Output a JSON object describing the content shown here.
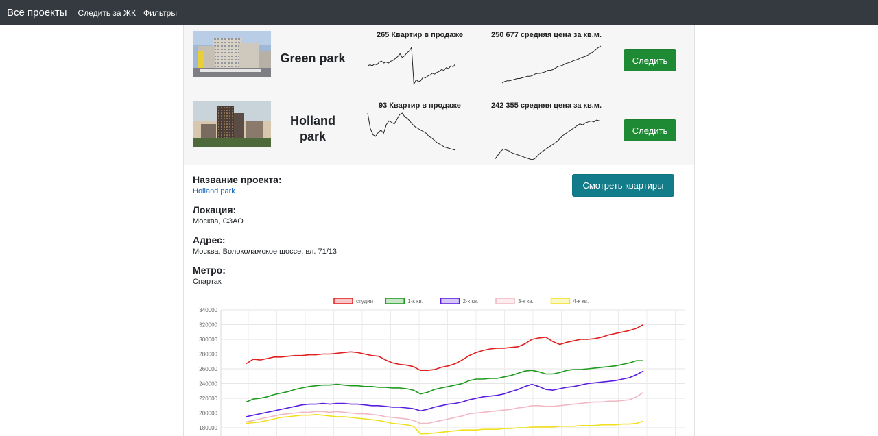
{
  "navbar": {
    "brand": "Все проекты",
    "links": [
      "Следить за ЖК",
      "Фильтры"
    ]
  },
  "projects": [
    {
      "name": "Green park",
      "flats_label": "265 Квартир в продаже",
      "price_label": "250 677 средняя цена за кв.м.",
      "follow_label": "Следить",
      "flats_trend": [
        20,
        21,
        20,
        22,
        21,
        24,
        25,
        23,
        24,
        23,
        25,
        26,
        28,
        30,
        33,
        29,
        31,
        34,
        36,
        40,
        0,
        5,
        3,
        4,
        8,
        7,
        9,
        10,
        12,
        11,
        13,
        14,
        16,
        15,
        18,
        17,
        20,
        19,
        22
      ],
      "price_trend": [
        0,
        2,
        3,
        3,
        4,
        5,
        6,
        6,
        7,
        8,
        9,
        9,
        10,
        12,
        13,
        13,
        14,
        15,
        17,
        17,
        18,
        20,
        22,
        23,
        24,
        26,
        27,
        28,
        30,
        31,
        32,
        34,
        35,
        36,
        38,
        40,
        42,
        45,
        48,
        50
      ]
    },
    {
      "name": "Holland park",
      "flats_label": "93 Квартир в продаже",
      "price_label": "242 355 средняя цена за кв.м.",
      "follow_label": "Следить",
      "flats_trend": [
        50,
        30,
        22,
        20,
        25,
        28,
        24,
        35,
        40,
        38,
        36,
        42,
        48,
        50,
        45,
        43,
        39,
        35,
        32,
        30,
        28,
        26,
        24,
        20,
        18,
        15,
        12,
        10,
        8,
        6,
        5,
        4,
        3,
        2
      ],
      "price_trend": [
        10,
        14,
        18,
        20,
        19,
        18,
        16,
        15,
        14,
        13,
        12,
        11,
        10,
        9,
        10,
        13,
        16,
        18,
        20,
        22,
        24,
        26,
        28,
        31,
        34,
        36,
        38,
        40,
        42,
        44,
        46,
        45,
        47,
        48,
        49,
        48,
        50,
        49
      ]
    }
  ],
  "details": {
    "name_heading": "Название проекта:",
    "name_value": "Holland park",
    "location_heading": "Локация:",
    "location_value": "Москва, СЗАО",
    "address_heading": "Адрес:",
    "address_value": "Москва, Волоколамское шоссе, вл. 71/13",
    "metro_heading": "Метро:",
    "metro_value": "Спартак",
    "view_button": "Смотреть квартиры"
  },
  "chart_data": {
    "type": "line",
    "title": "",
    "legend_position": "top",
    "grid": true,
    "ylim": [
      170000,
      340000
    ],
    "yticks": [
      340000,
      320000,
      300000,
      280000,
      260000,
      240000,
      220000,
      200000,
      180000
    ],
    "x_count": 58,
    "series": [
      {
        "name": "студии",
        "color": "#e02020",
        "values": [
          267000,
          273000,
          272000,
          274000,
          276000,
          276000,
          277000,
          278000,
          278000,
          279000,
          279000,
          280000,
          280000,
          281000,
          282000,
          283000,
          282000,
          280000,
          278000,
          277000,
          272000,
          268000,
          266000,
          265000,
          263000,
          258000,
          258000,
          259000,
          262000,
          264000,
          267000,
          272000,
          278000,
          282000,
          285000,
          287000,
          288000,
          288000,
          289000,
          290000,
          294000,
          300000,
          302000,
          303000,
          297000,
          293000,
          296000,
          298000,
          300000,
          300000,
          301000,
          303000,
          306000,
          308000,
          310000,
          312000,
          315000,
          320000
        ]
      },
      {
        "name": "1-к кв.",
        "color": "#1e9a1e",
        "values": [
          215000,
          219000,
          220000,
          222000,
          225000,
          227000,
          229000,
          232000,
          234000,
          236000,
          237000,
          238000,
          238000,
          239000,
          238000,
          237000,
          237000,
          236000,
          236000,
          235000,
          235000,
          234000,
          234000,
          233000,
          231000,
          226000,
          228000,
          232000,
          234000,
          236000,
          238000,
          240000,
          244000,
          246000,
          246000,
          247000,
          247000,
          249000,
          251000,
          254000,
          257000,
          258000,
          256000,
          253000,
          253000,
          255000,
          258000,
          259000,
          259000,
          260000,
          261000,
          262000,
          263000,
          264000,
          266000,
          268000,
          271000,
          271000
        ]
      },
      {
        "name": "2-к кв.",
        "color": "#5a1ee0",
        "values": [
          195000,
          197000,
          199000,
          201000,
          203000,
          205000,
          207000,
          209000,
          211000,
          212000,
          212000,
          213000,
          212000,
          213000,
          213000,
          212000,
          212000,
          211000,
          210000,
          210000,
          209000,
          208000,
          208000,
          207000,
          206000,
          203000,
          205000,
          208000,
          210000,
          212000,
          213000,
          215000,
          218000,
          220000,
          222000,
          223000,
          224000,
          226000,
          229000,
          232000,
          236000,
          239000,
          236000,
          232000,
          231000,
          233000,
          235000,
          236000,
          238000,
          240000,
          241000,
          242000,
          243000,
          244000,
          246000,
          248000,
          252000,
          257000
        ]
      },
      {
        "name": "3-к кв.",
        "color": "#f0b8c4",
        "values": [
          188000,
          190000,
          192000,
          194000,
          196000,
          198000,
          199000,
          200000,
          201000,
          201000,
          202000,
          202000,
          201000,
          202000,
          201000,
          200000,
          199000,
          199000,
          198000,
          197000,
          195000,
          194000,
          193000,
          192000,
          190000,
          186000,
          186000,
          188000,
          190000,
          192000,
          194000,
          196000,
          199000,
          200000,
          201000,
          202000,
          203000,
          204000,
          205000,
          207000,
          208000,
          210000,
          210000,
          209000,
          209000,
          210000,
          211000,
          212000,
          213000,
          214000,
          215000,
          215000,
          216000,
          216000,
          217000,
          218000,
          222000,
          228000
        ]
      },
      {
        "name": "4-к кв.",
        "color": "#f0e020",
        "values": [
          186000,
          187000,
          188000,
          190000,
          192000,
          194000,
          195000,
          196000,
          197000,
          197000,
          198000,
          197000,
          196000,
          195000,
          195000,
          194000,
          193000,
          192000,
          191000,
          190000,
          188000,
          186000,
          185000,
          184000,
          182000,
          172000,
          172000,
          173000,
          174000,
          175000,
          176000,
          177000,
          177000,
          177000,
          178000,
          178000,
          178000,
          179000,
          179000,
          180000,
          180000,
          181000,
          181000,
          181000,
          181000,
          182000,
          182000,
          182000,
          183000,
          183000,
          183000,
          184000,
          184000,
          184000,
          185000,
          185000,
          186000,
          189000
        ]
      }
    ]
  }
}
